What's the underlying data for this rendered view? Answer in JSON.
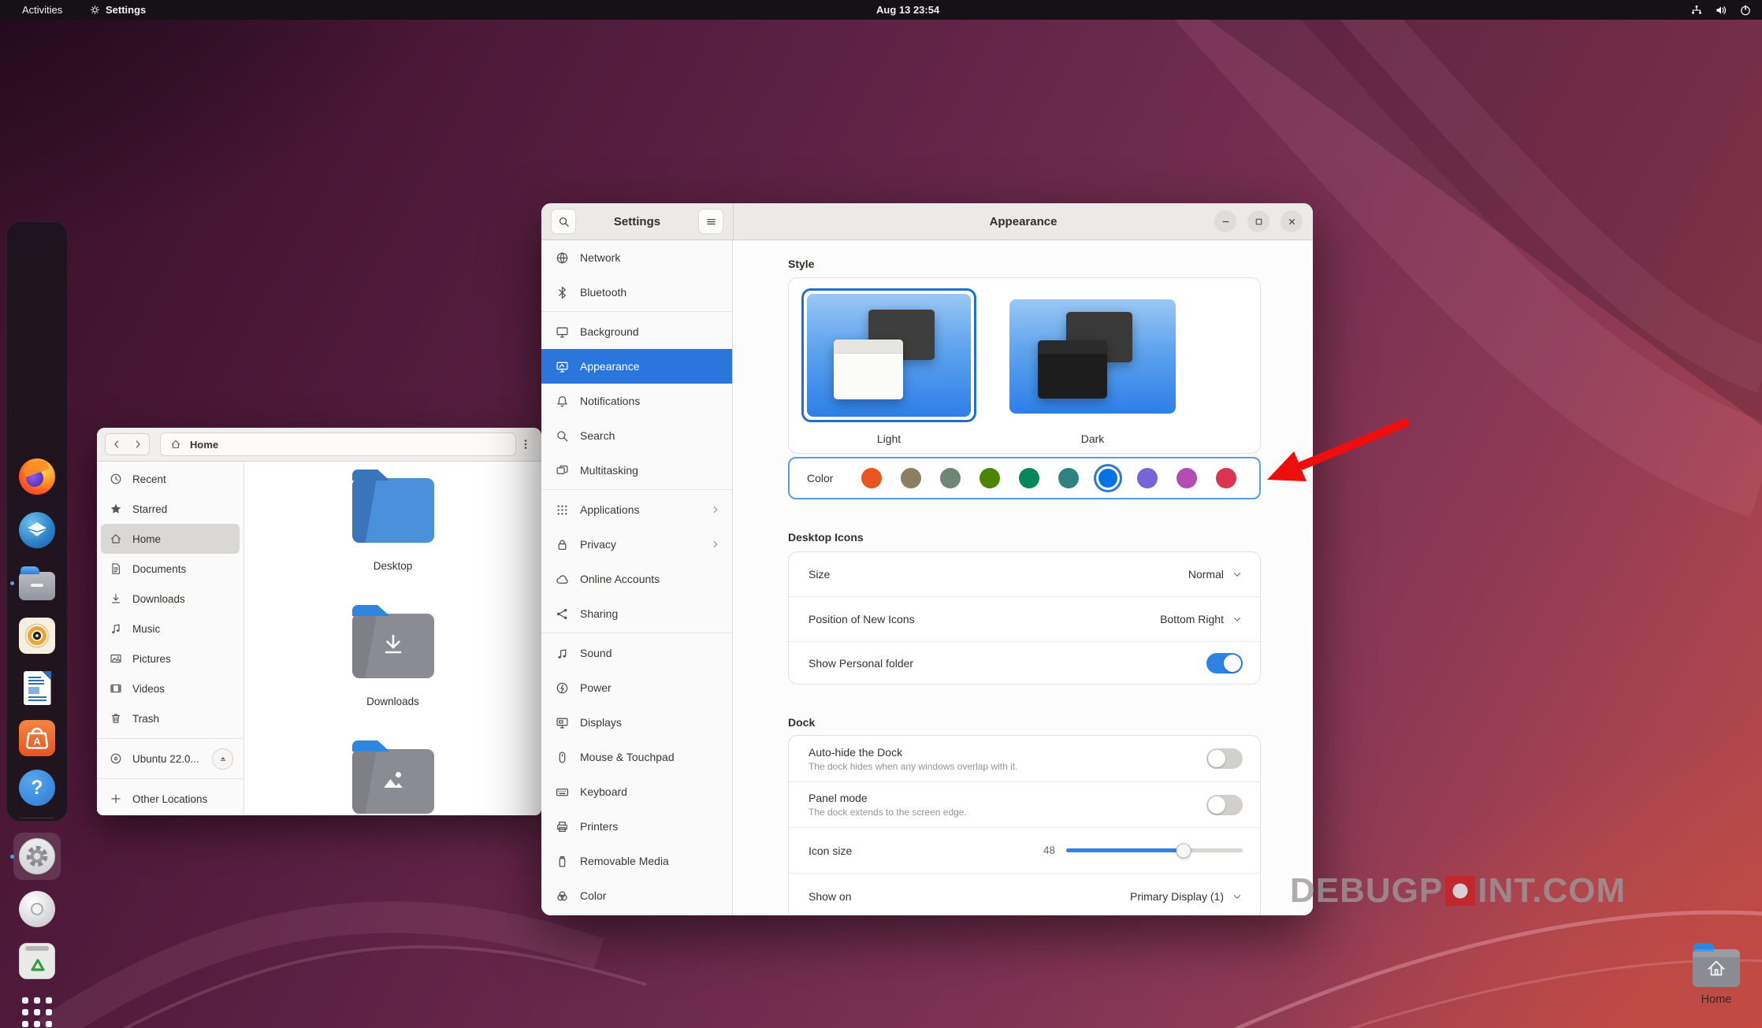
{
  "topbar": {
    "activities_label": "Activities",
    "focused_app": "Settings",
    "clock": "Aug 13 23:54",
    "tray_icons": [
      "network",
      "volume",
      "power"
    ]
  },
  "dock": {
    "items": [
      {
        "name": "firefox",
        "running": false
      },
      {
        "name": "thunderbird",
        "running": false
      },
      {
        "name": "files",
        "running": true
      },
      {
        "name": "rhythmbox",
        "running": false
      },
      {
        "name": "libreoffice-writer",
        "running": false
      },
      {
        "name": "ubuntu-software",
        "running": false
      },
      {
        "name": "help",
        "running": false,
        "separator_after": true
      },
      {
        "name": "settings",
        "running": true,
        "active": true
      },
      {
        "name": "disc",
        "running": false
      },
      {
        "name": "trash",
        "running": false
      },
      {
        "name": "app-grid",
        "running": false
      }
    ]
  },
  "files_window": {
    "path_label": "Home",
    "sidebar": [
      {
        "label": "Recent",
        "icon": "recent"
      },
      {
        "label": "Starred",
        "icon": "starred"
      },
      {
        "label": "Home",
        "icon": "home",
        "selected": true
      },
      {
        "label": "Documents",
        "icon": "documents"
      },
      {
        "label": "Downloads",
        "icon": "downloads"
      },
      {
        "label": "Music",
        "icon": "music"
      },
      {
        "label": "Pictures",
        "icon": "pictures"
      },
      {
        "label": "Videos",
        "icon": "videos"
      },
      {
        "label": "Trash",
        "icon": "trash",
        "separator_after": true
      },
      {
        "label": "Ubuntu 22.0...",
        "icon": "disc",
        "eject": true,
        "separator_after": true
      },
      {
        "label": "Other Locations",
        "icon": "plus"
      }
    ],
    "folders": [
      {
        "label": "Desktop",
        "style": "blue",
        "emblem": "none"
      },
      {
        "label": "Downloads",
        "style": "gray",
        "emblem": "download"
      },
      {
        "label": "",
        "style": "gray",
        "emblem": "pictures"
      }
    ]
  },
  "settings_window": {
    "title": "Settings",
    "panel_title": "Appearance",
    "window_controls": [
      "minimize",
      "maximize",
      "close"
    ],
    "accent_color": "#2a76dd",
    "sidebar": {
      "items": [
        {
          "label": "Network",
          "icon": "network"
        },
        {
          "label": "Bluetooth",
          "icon": "bluetooth",
          "separator_after": true
        },
        {
          "label": "Background",
          "icon": "background"
        },
        {
          "label": "Appearance",
          "icon": "appearance",
          "selected": true
        },
        {
          "label": "Notifications",
          "icon": "notifications"
        },
        {
          "label": "Search",
          "icon": "search"
        },
        {
          "label": "Multitasking",
          "icon": "multitasking",
          "separator_after": true
        },
        {
          "label": "Applications",
          "icon": "applications",
          "chevron": true
        },
        {
          "label": "Privacy",
          "icon": "privacy",
          "chevron": true
        },
        {
          "label": "Online Accounts",
          "icon": "online-accounts"
        },
        {
          "label": "Sharing",
          "icon": "sharing",
          "separator_after": true
        },
        {
          "label": "Sound",
          "icon": "sound"
        },
        {
          "label": "Power",
          "icon": "power"
        },
        {
          "label": "Displays",
          "icon": "displays"
        },
        {
          "label": "Mouse & Touchpad",
          "icon": "mouse"
        },
        {
          "label": "Keyboard",
          "icon": "keyboard"
        },
        {
          "label": "Printers",
          "icon": "printers"
        },
        {
          "label": "Removable Media",
          "icon": "removable-media"
        },
        {
          "label": "Color",
          "icon": "color"
        }
      ]
    },
    "style_section": {
      "heading": "Style",
      "options": [
        {
          "label": "Light",
          "selected": true
        },
        {
          "label": "Dark",
          "selected": false
        }
      ]
    },
    "color_row": {
      "label": "Color",
      "selected_index": 6,
      "swatches": [
        "#E95420",
        "#8A7F63",
        "#6E8775",
        "#4B8501",
        "#03875B",
        "#308280",
        "#0073E5",
        "#7764D8",
        "#B34CB3",
        "#DA3450"
      ]
    },
    "desktop_icons_section": {
      "heading": "Desktop Icons",
      "rows": [
        {
          "label": "Size",
          "value": "Normal",
          "control": "dropdown"
        },
        {
          "label": "Position of New Icons",
          "value": "Bottom Right",
          "control": "dropdown"
        },
        {
          "label": "Show Personal folder",
          "control": "toggle",
          "on": true
        }
      ]
    },
    "dock_section": {
      "heading": "Dock",
      "rows": [
        {
          "label": "Auto-hide the Dock",
          "subtitle": "The dock hides when any windows overlap with it.",
          "control": "toggle",
          "on": false
        },
        {
          "label": "Panel mode",
          "subtitle": "The dock extends to the screen edge.",
          "control": "toggle",
          "on": false
        },
        {
          "label": "Icon size",
          "value": "48",
          "control": "slider",
          "slider_fill": 0.665
        },
        {
          "label": "Show on",
          "value": "Primary Display (1)",
          "control": "dropdown"
        }
      ]
    }
  },
  "annotation_arrow": {
    "color": "#ef0e0e",
    "points_at": "color-row"
  },
  "watermark": {
    "part1": "DEBUGP",
    "part2": "INT.COM"
  },
  "desktop": {
    "home_icon_label": "Home"
  }
}
